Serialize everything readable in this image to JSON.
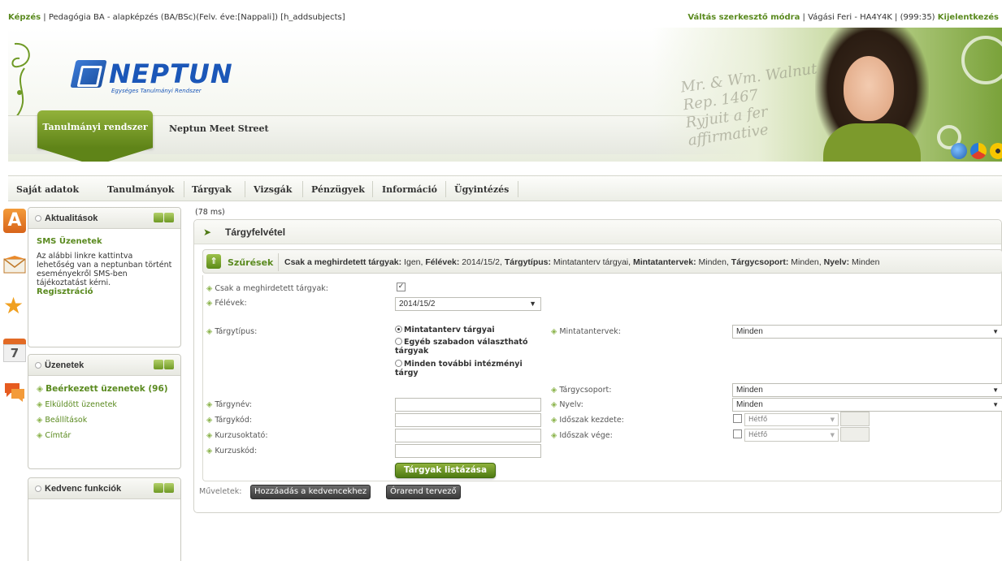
{
  "top": {
    "crumb_start": "Képzés",
    "crumb_rest": "| Pedagógia BA - alapképzés (BA/BSc)(Felv. éve:[Nappali]) [h_addsubjects]",
    "mode_link": "Váltás szerkesztő módra",
    "user": "| Vágási Feri - HA4Y4K | (999:35)",
    "logout": "Kijelentkezés"
  },
  "brand": {
    "logo_text": "NEPTUN",
    "logo_sub": "Egységes Tanulmányi Rendszer",
    "tab_active": "Tanulmányi rendszer",
    "tab_other": "Neptun Meet Street"
  },
  "nav": [
    "Saját adatok",
    "Tanulmányok",
    "Tárgyak",
    "Vizsgák",
    "Pénzügyek",
    "Információ",
    "Ügyintézés"
  ],
  "calendar_day": "7",
  "panels": {
    "news": {
      "title": "Aktualitások",
      "sms_title": "SMS Üzenetek",
      "sms_text": "Az alábbi linkre kattintva lehetőség van a neptunban történt eseményekről SMS-ben tájékoztatást kérni.",
      "sms_link": "Regisztráció"
    },
    "messages": {
      "title": "Üzenetek",
      "items": [
        "Beérkezett üzenetek (96)",
        "Elküldött üzenetek",
        "Beállítások",
        "Címtár"
      ]
    },
    "favorites": {
      "title": "Kedvenc funkciók"
    }
  },
  "timing": "(78 ms)",
  "content": {
    "title": "Tárgyfelvétel",
    "filter_label": "Szűrések",
    "filter_summary": [
      {
        "k": "Csak a meghirdetett tárgyak:",
        "v": " Igen, "
      },
      {
        "k": "Félévek:",
        "v": " 2014/15/2, "
      },
      {
        "k": "Tárgytípus:",
        "v": " Mintatanterv tárgyai, "
      },
      {
        "k": "Mintatantervek:",
        "v": " Minden, "
      },
      {
        "k": "Tárgycsoport:",
        "v": " Minden, "
      },
      {
        "k": "Nyelv:",
        "v": " Minden"
      }
    ],
    "form": {
      "only_announced_label": "Csak a meghirdetett tárgyak:",
      "only_announced_checked": true,
      "semester_label": "Félévek:",
      "semester_value": "2014/15/2",
      "subject_type_label": "Tárgytípus:",
      "subject_type_options": [
        "Mintatanterv tárgyai",
        "Egyéb szabadon választható tárgyak",
        "Minden további intézményi tárgy"
      ],
      "subject_type_selected": 0,
      "curricula_label": "Mintatantervek:",
      "curricula_value": "Minden",
      "subject_group_label": "Tárgycsoport:",
      "subject_group_value": "Minden",
      "language_label": "Nyelv:",
      "language_value": "Minden",
      "subject_name_label": "Tárgynév:",
      "subject_code_label": "Tárgykód:",
      "course_teacher_label": "Kurzusoktató:",
      "course_code_label": "Kurzuskód:",
      "period_start_label": "Időszak kezdete:",
      "period_end_label": "Időszak vége:",
      "day_value": "Hétfő",
      "list_button": "Tárgyak listázása"
    },
    "ops_label": "Műveletek:",
    "add_fav_button": "Hozzáadás a kedvencekhez",
    "timetable_button": "Órarend tervező"
  },
  "colors": {
    "accent": "#5a8a1f",
    "brand_blue": "#1b57b8",
    "tab_green": "#6f9a25"
  }
}
